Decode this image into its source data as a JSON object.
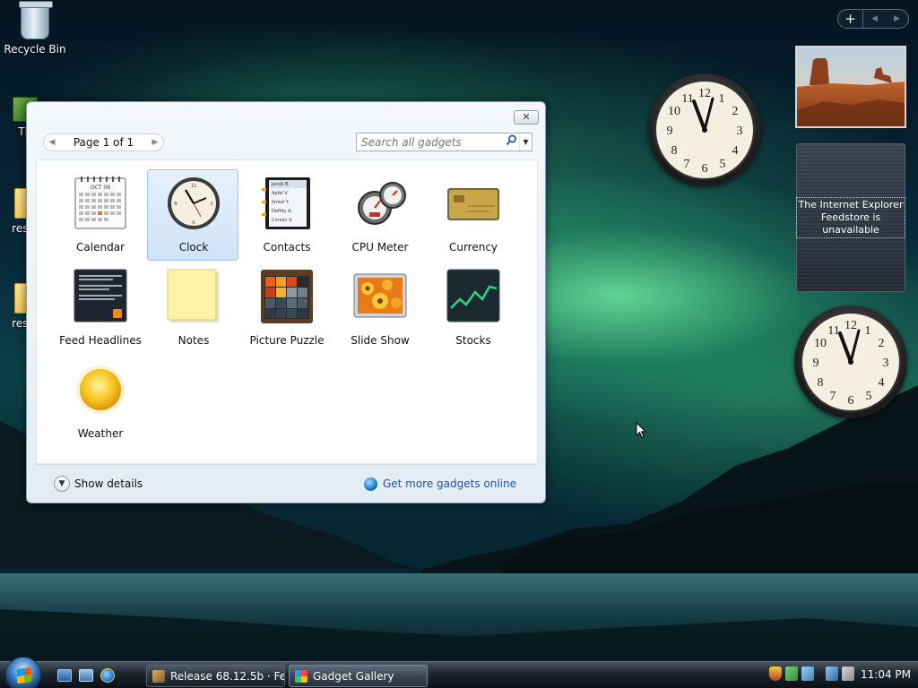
{
  "desktop": {
    "icons": [
      {
        "label": "Recycle Bin"
      },
      {
        "label": "TLa"
      },
      {
        "label": "reso"
      },
      {
        "label": "reso"
      }
    ]
  },
  "sidebar": {
    "add_glyph": "+",
    "prev_glyph": "◀",
    "next_glyph": "▶",
    "feed_message": "The Internet Explorer Feedstore is unavailable"
  },
  "gallery": {
    "close_glyph": "✕",
    "pager": {
      "prev_glyph": "◀",
      "text": "Page 1 of 1",
      "next_glyph": "▶"
    },
    "search": {
      "placeholder": "Search all gadgets",
      "value": ""
    },
    "gadgets": [
      {
        "label": "Calendar",
        "selected": false
      },
      {
        "label": "Clock",
        "selected": true
      },
      {
        "label": "Contacts",
        "selected": false
      },
      {
        "label": "CPU Meter",
        "selected": false
      },
      {
        "label": "Currency",
        "selected": false
      },
      {
        "label": "Feed Headlines",
        "selected": false
      },
      {
        "label": "Notes",
        "selected": false
      },
      {
        "label": "Picture Puzzle",
        "selected": false
      },
      {
        "label": "Slide Show",
        "selected": false
      },
      {
        "label": "Stocks",
        "selected": false
      },
      {
        "label": "Weather",
        "selected": false
      }
    ],
    "calendar_month": "OCT 06",
    "contacts_names": [
      "Jacob B.",
      "Apfel V.",
      "Smiet Y.",
      "Deffdy A.",
      "Corson V."
    ],
    "show_details": "Show details",
    "more_gadgets": "Get more gadgets online"
  },
  "taskbar": {
    "tasks": [
      {
        "label": "Release 68.12.5b · Fe...",
        "active": false
      },
      {
        "label": "Gadget Gallery",
        "active": true
      }
    ],
    "time": "11:04 PM"
  },
  "colors": {
    "link": "#1c55a8",
    "selection": "#cfe3f7",
    "aurora": "#78ffaa"
  }
}
